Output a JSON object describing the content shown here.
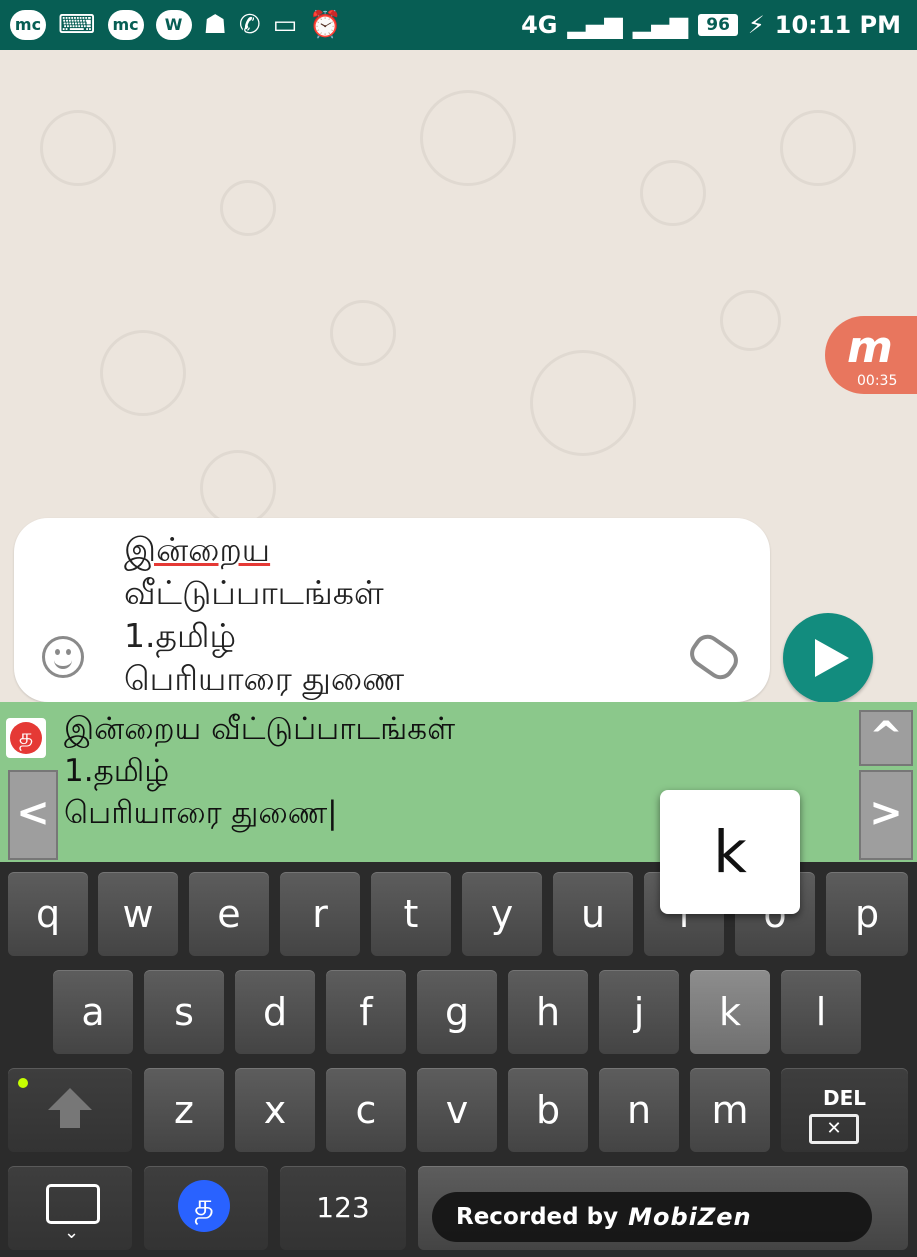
{
  "status_bar": {
    "time": "10:11 PM",
    "battery": "96",
    "network": "4G",
    "left_icons": [
      "mc-icon",
      "keyboard-icon",
      "mc-icon",
      "w-icon",
      "android-icon",
      "wifi-call-icon",
      "cast-icon",
      "alarm-icon"
    ]
  },
  "recording_bubble": {
    "letter": "m",
    "time": "00:35"
  },
  "input": {
    "lines": [
      "இன்றைய",
      "வீட்டுப்பாடங்கள்",
      "1.தமிழ்",
      "பெரியாரை துணை"
    ]
  },
  "ime_strip": {
    "lines": [
      "இன்றைய வீட்டுப்பாடங்கள்",
      "1.தமிழ்",
      "பெரியாரை துணை|"
    ],
    "app_glyph": "த",
    "left_arrow": "<",
    "right_arrow": ">",
    "up_arrow": "^"
  },
  "key_popup": "k",
  "keyboard": {
    "row1": [
      "q",
      "w",
      "e",
      "r",
      "t",
      "y",
      "u",
      "i",
      "o",
      "p"
    ],
    "row2": [
      "a",
      "s",
      "d",
      "f",
      "g",
      "h",
      "j",
      "k",
      "l"
    ],
    "row3": [
      "z",
      "x",
      "c",
      "v",
      "b",
      "n",
      "m"
    ],
    "del_label": "DEL",
    "del_symbol": "✕",
    "num_label": "123",
    "tamil_key": "த",
    "kb_chevron": "⌄"
  },
  "watermark": {
    "text": "Recorded by",
    "brand": "MobiZen"
  },
  "colors": {
    "status_bar": "#075e54",
    "send_button": "#128c7e",
    "ime_strip": "#8bc88b",
    "keyboard": "#2b2b2b"
  }
}
